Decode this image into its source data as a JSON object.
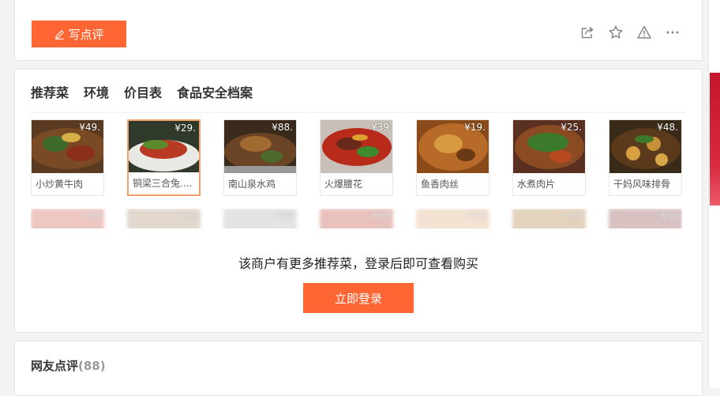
{
  "top": {
    "write_review_label": "写点评",
    "icons": [
      "share-icon",
      "star-icon",
      "warning-icon",
      "more-icon"
    ]
  },
  "dishes_section": {
    "tabs": [
      "推荐菜",
      "环境",
      "价目表",
      "食品安全档案"
    ],
    "active_tab": "推荐菜",
    "row1": [
      {
        "name": "小炒黄牛肉",
        "price": "¥49."
      },
      {
        "name": "铜梁三合兔....",
        "price": "¥29."
      },
      {
        "name": "南山泉水鸡",
        "price": "¥88."
      },
      {
        "name": "火爆腰花",
        "price": "¥39"
      },
      {
        "name": "鱼香肉丝",
        "price": "¥19."
      },
      {
        "name": "水煮肉片",
        "price": "¥25."
      },
      {
        "name": "干妈风味排骨",
        "price": "¥48."
      }
    ],
    "row2": [
      {
        "price": "¥89"
      },
      {
        "price": "¥28"
      },
      {
        "price": "¥20"
      },
      {
        "price": "¥68"
      },
      {
        "price": "¥15"
      },
      {
        "price": "¥19"
      },
      {
        "price": "¥18"
      }
    ],
    "more_message": "该商户有更多推荐菜，登录后即可查看购买",
    "login_label": "立即登录"
  },
  "reviews": {
    "title": "网友点评",
    "count": "(88)"
  },
  "colors": {
    "accent": "#ff6633",
    "selected_border": "#f3a26e"
  }
}
